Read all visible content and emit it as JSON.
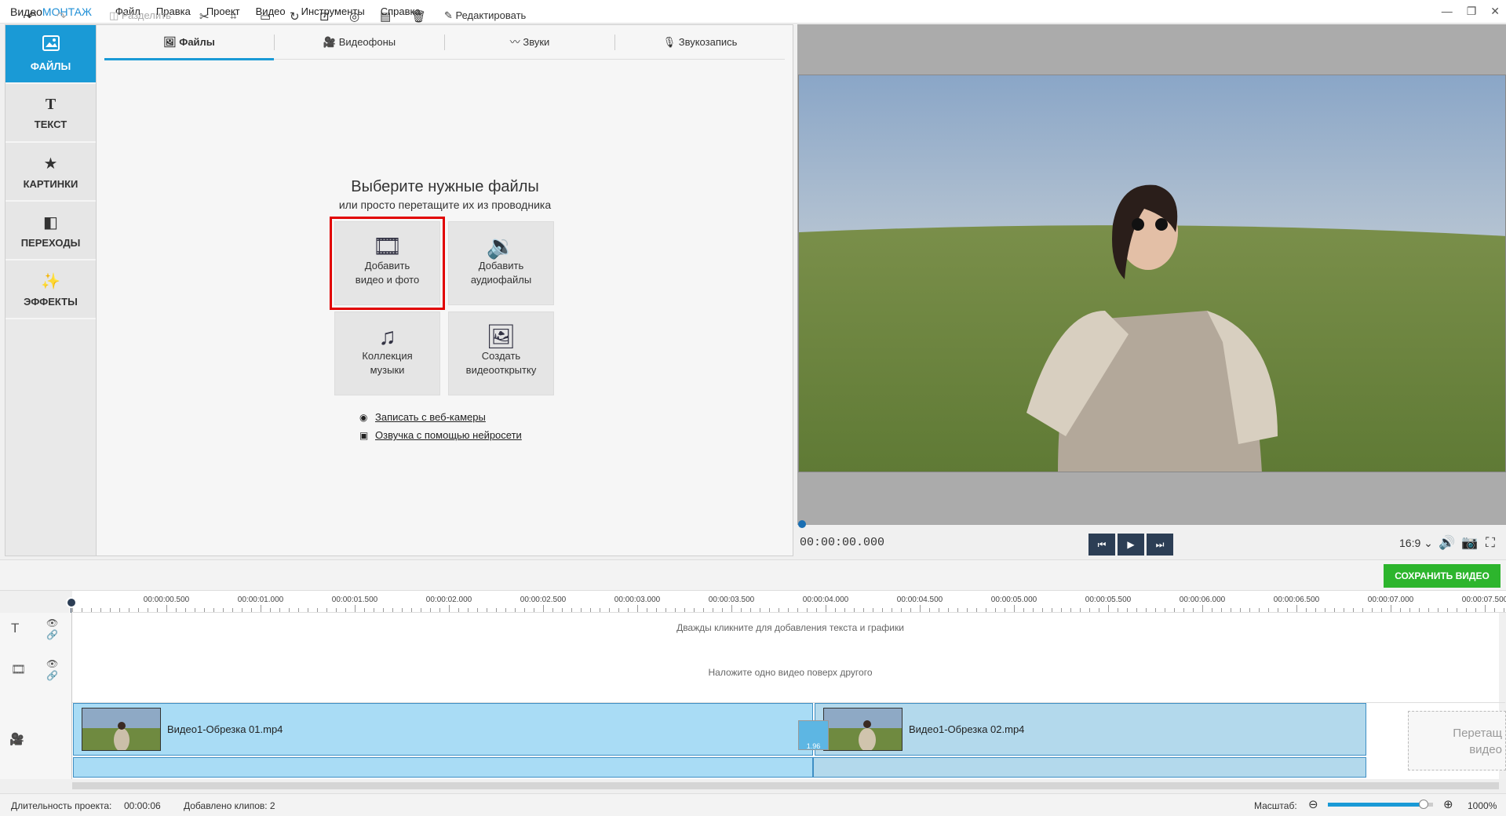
{
  "app": {
    "logo_pre": "Видео",
    "logo_brand": "МОНТАЖ"
  },
  "menu": [
    "Файл",
    "Правка",
    "Проект",
    "Видео",
    "Инструменты",
    "Справка"
  ],
  "sidebar": [
    {
      "label": "ФАЙЛЫ",
      "icon": "image-icon",
      "active": true
    },
    {
      "label": "ТЕКСТ",
      "icon": "text-icon",
      "active": false
    },
    {
      "label": "КАРТИНКИ",
      "icon": "star-icon",
      "active": false
    },
    {
      "label": "ПЕРЕХОДЫ",
      "icon": "transition-icon",
      "active": false
    },
    {
      "label": "ЭФФЕКТЫ",
      "icon": "wand-icon",
      "active": false
    }
  ],
  "tabs": [
    "Файлы",
    "Видеофоны",
    "Звуки",
    "Звукозапись"
  ],
  "panel": {
    "title": "Выберите нужные файлы",
    "subtitle": "или просто перетащите их из проводника",
    "tiles": [
      {
        "line1": "Добавить",
        "line2": "видео и фото",
        "icon": "film-reel-icon"
      },
      {
        "line1": "Добавить",
        "line2": "аудиофайлы",
        "icon": "audio-file-icon"
      },
      {
        "line1": "Коллекция",
        "line2": "музыки",
        "icon": "music-notes-icon"
      },
      {
        "line1": "Создать",
        "line2": "видеооткрытку",
        "icon": "postcard-icon"
      }
    ],
    "links": [
      "Записать с веб-камеры",
      "Озвучка с помощью нейросети"
    ]
  },
  "player": {
    "time": "00:00:00.000",
    "aspect": "16:9"
  },
  "toolbar": {
    "split": "Разделить",
    "edit": "Редактировать",
    "save": "СОХРАНИТЬ ВИДЕО"
  },
  "ruler": [
    "00:00:00.500",
    "00:00:01.000",
    "00:00:01.500",
    "00:00:02.000",
    "00:00:02.500",
    "00:00:03.000",
    "00:00:03.500",
    "00:00:04.000",
    "00:00:04.500",
    "00:00:05.000",
    "00:00:05.500",
    "00:00:06.000",
    "00:00:06.500",
    "00:00:07.000",
    "00:00:07.500"
  ],
  "timeline": {
    "text_hint": "Дважды кликните для добавления текста и графики",
    "overlay_hint": "Наложите одно видео поверх другого",
    "clips": [
      "Видео1-Обрезка 01.mp4",
      "Видео1-Обрезка 02.mp4"
    ],
    "transition_duration": "1.96",
    "drop_line1": "Перетащ",
    "drop_line2": "видео"
  },
  "status": {
    "duration_label": "Длительность проекта:",
    "duration": "00:00:06",
    "clips": "Добавлено клипов: 2",
    "zoom_label": "Масштаб:",
    "zoom": "1000%",
    "zoom_level": 0.91
  }
}
